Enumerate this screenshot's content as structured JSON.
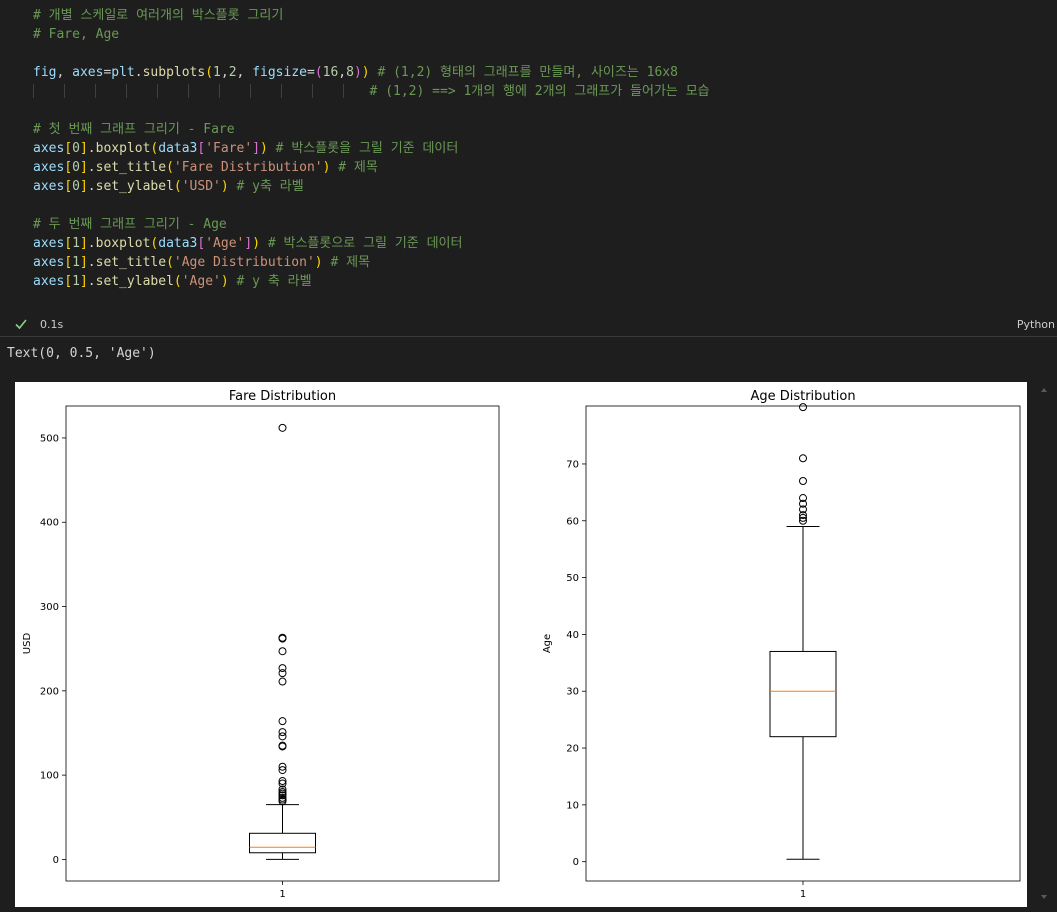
{
  "code": {
    "lines": [
      {
        "top": 6,
        "tokens": [
          {
            "c": "com",
            "t": "# 개별 스케일로 여러개의 박스플롯 그리기"
          }
        ]
      },
      {
        "top": 25,
        "tokens": [
          {
            "c": "com",
            "t": "# Fare, Age"
          }
        ]
      },
      {
        "top": 63,
        "tokens": [
          {
            "c": "var",
            "t": "fig"
          },
          {
            "c": "pl",
            "t": ", "
          },
          {
            "c": "var",
            "t": "axes"
          },
          {
            "c": "pl",
            "t": "="
          },
          {
            "c": "var",
            "t": "plt"
          },
          {
            "c": "pl",
            "t": "."
          },
          {
            "c": "fn",
            "t": "subplots"
          },
          {
            "c": "br1",
            "t": "("
          },
          {
            "c": "num",
            "t": "1"
          },
          {
            "c": "pl",
            "t": ","
          },
          {
            "c": "num",
            "t": "2"
          },
          {
            "c": "pl",
            "t": ", "
          },
          {
            "c": "var",
            "t": "figsize"
          },
          {
            "c": "pl",
            "t": "="
          },
          {
            "c": "br2",
            "t": "("
          },
          {
            "c": "num",
            "t": "16"
          },
          {
            "c": "pl",
            "t": ","
          },
          {
            "c": "num",
            "t": "8"
          },
          {
            "c": "br2",
            "t": ")"
          },
          {
            "c": "br1",
            "t": ")"
          },
          {
            "c": "pl",
            "t": " "
          },
          {
            "c": "com",
            "t": "# (1,2) 형태의 그래프를 만들며, 사이즈는 16x8"
          }
        ]
      },
      {
        "top": 82,
        "tokens": [
          {
            "c": "pl",
            "t": "                                           "
          },
          {
            "c": "com",
            "t": "# (1,2) ==> 1개의 행에 2개의 그래프가 들어가는 모습"
          }
        ]
      },
      {
        "top": 120,
        "tokens": [
          {
            "c": "com",
            "t": "# 첫 번째 그래프 그리기 - Fare"
          }
        ]
      },
      {
        "top": 139,
        "tokens": [
          {
            "c": "var",
            "t": "axes"
          },
          {
            "c": "br1",
            "t": "["
          },
          {
            "c": "num",
            "t": "0"
          },
          {
            "c": "br1",
            "t": "]"
          },
          {
            "c": "pl",
            "t": "."
          },
          {
            "c": "fn",
            "t": "boxplot"
          },
          {
            "c": "br1",
            "t": "("
          },
          {
            "c": "var",
            "t": "data3"
          },
          {
            "c": "br2",
            "t": "["
          },
          {
            "c": "str",
            "t": "'Fare'"
          },
          {
            "c": "br2",
            "t": "]"
          },
          {
            "c": "br1",
            "t": ")"
          },
          {
            "c": "pl",
            "t": " "
          },
          {
            "c": "com",
            "t": "# 박스플롯을 그릴 기준 데이터"
          }
        ]
      },
      {
        "top": 158,
        "tokens": [
          {
            "c": "var",
            "t": "axes"
          },
          {
            "c": "br1",
            "t": "["
          },
          {
            "c": "num",
            "t": "0"
          },
          {
            "c": "br1",
            "t": "]"
          },
          {
            "c": "pl",
            "t": "."
          },
          {
            "c": "fn",
            "t": "set_title"
          },
          {
            "c": "br1",
            "t": "("
          },
          {
            "c": "str",
            "t": "'Fare Distribution'"
          },
          {
            "c": "br1",
            "t": ")"
          },
          {
            "c": "pl",
            "t": " "
          },
          {
            "c": "com",
            "t": "# 제목"
          }
        ]
      },
      {
        "top": 177,
        "tokens": [
          {
            "c": "var",
            "t": "axes"
          },
          {
            "c": "br1",
            "t": "["
          },
          {
            "c": "num",
            "t": "0"
          },
          {
            "c": "br1",
            "t": "]"
          },
          {
            "c": "pl",
            "t": "."
          },
          {
            "c": "fn",
            "t": "set_ylabel"
          },
          {
            "c": "br1",
            "t": "("
          },
          {
            "c": "str",
            "t": "'USD'"
          },
          {
            "c": "br1",
            "t": ")"
          },
          {
            "c": "pl",
            "t": " "
          },
          {
            "c": "com",
            "t": "# y축 라벨"
          }
        ]
      },
      {
        "top": 215,
        "tokens": [
          {
            "c": "com",
            "t": "# 두 번째 그래프 그리기 - Age"
          }
        ]
      },
      {
        "top": 234,
        "tokens": [
          {
            "c": "var",
            "t": "axes"
          },
          {
            "c": "br1",
            "t": "["
          },
          {
            "c": "num",
            "t": "1"
          },
          {
            "c": "br1",
            "t": "]"
          },
          {
            "c": "pl",
            "t": "."
          },
          {
            "c": "fn",
            "t": "boxplot"
          },
          {
            "c": "br1",
            "t": "("
          },
          {
            "c": "var",
            "t": "data3"
          },
          {
            "c": "br2",
            "t": "["
          },
          {
            "c": "str",
            "t": "'Age'"
          },
          {
            "c": "br2",
            "t": "]"
          },
          {
            "c": "br1",
            "t": ")"
          },
          {
            "c": "pl",
            "t": " "
          },
          {
            "c": "com",
            "t": "# 박스플롯으로 그릴 기준 데이터"
          }
        ]
      },
      {
        "top": 253,
        "tokens": [
          {
            "c": "var",
            "t": "axes"
          },
          {
            "c": "br1",
            "t": "["
          },
          {
            "c": "num",
            "t": "1"
          },
          {
            "c": "br1",
            "t": "]"
          },
          {
            "c": "pl",
            "t": "."
          },
          {
            "c": "fn",
            "t": "set_title"
          },
          {
            "c": "br1",
            "t": "("
          },
          {
            "c": "str",
            "t": "'Age Distribution'"
          },
          {
            "c": "br1",
            "t": ")"
          },
          {
            "c": "pl",
            "t": " "
          },
          {
            "c": "com",
            "t": "# 제목"
          }
        ]
      },
      {
        "top": 272,
        "tokens": [
          {
            "c": "var",
            "t": "axes"
          },
          {
            "c": "br1",
            "t": "["
          },
          {
            "c": "num",
            "t": "1"
          },
          {
            "c": "br1",
            "t": "]"
          },
          {
            "c": "pl",
            "t": "."
          },
          {
            "c": "fn",
            "t": "set_ylabel"
          },
          {
            "c": "br1",
            "t": "("
          },
          {
            "c": "str",
            "t": "'Age'"
          },
          {
            "c": "br1",
            "t": ")"
          },
          {
            "c": "pl",
            "t": " "
          },
          {
            "c": "com",
            "t": "# y 축 라벨"
          }
        ]
      }
    ]
  },
  "status": {
    "exec_time": "0.1s",
    "language": "Python",
    "icons": {
      "success": "check-icon"
    }
  },
  "output": {
    "text": "Text(0, 0.5, 'Age')"
  },
  "colors": {
    "median": "#ff7f0e",
    "check": "#89d185",
    "background": "#1e1e1e"
  },
  "chart_data": [
    {
      "type": "box",
      "title": "Fare Distribution",
      "xlabel": "",
      "ylabel": "USD",
      "categories": [
        "1"
      ],
      "ylim": [
        -25.6,
        537.9
      ],
      "yticks": [
        0,
        100,
        200,
        300,
        400,
        500
      ],
      "box": {
        "whisker_low": 0,
        "q1": 7.9,
        "median": 14.5,
        "q3": 31,
        "whisker_high": 65
      },
      "outliers": [
        512,
        263,
        262,
        247,
        227,
        221,
        211,
        164,
        151,
        146,
        135,
        134,
        110,
        106,
        93,
        90,
        83,
        80,
        78,
        76,
        73,
        71,
        69
      ]
    },
    {
      "type": "box",
      "title": "Age Distribution",
      "xlabel": "",
      "ylabel": "Age",
      "categories": [
        "1"
      ],
      "ylim": [
        -3.4,
        80.2
      ],
      "yticks": [
        0,
        10,
        20,
        30,
        40,
        50,
        60,
        70
      ],
      "box": {
        "whisker_low": 0.42,
        "q1": 22,
        "median": 30,
        "q3": 37,
        "whisker_high": 59
      },
      "outliers": [
        80,
        71,
        67,
        64,
        63,
        62,
        61,
        60.5,
        60
      ]
    }
  ]
}
